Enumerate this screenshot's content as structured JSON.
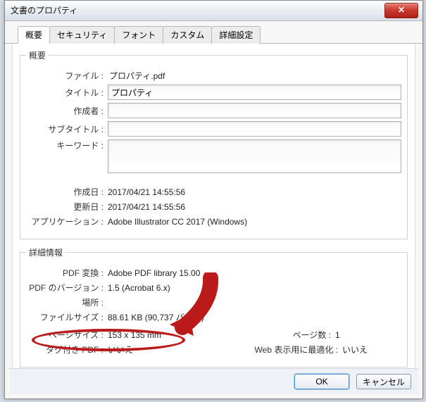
{
  "window": {
    "title": "文書のプロパティ"
  },
  "tabs": {
    "items": [
      {
        "label": "概要"
      },
      {
        "label": "セキュリティ"
      },
      {
        "label": "フォント"
      },
      {
        "label": "カスタム"
      },
      {
        "label": "詳細設定"
      }
    ]
  },
  "section_overview": {
    "legend": "概要",
    "file_label": "ファイル :",
    "file_value": "プロパティ.pdf",
    "title_label": "タイトル :",
    "title_value": "プロパティ",
    "author_label": "作成者 :",
    "author_value": "",
    "subtitle_label": "サブタイトル :",
    "subtitle_value": "",
    "keywords_label": "キーワード :",
    "keywords_value": "",
    "created_label": "作成日 :",
    "created_value": "2017/04/21 14:55:56",
    "updated_label": "更新日 :",
    "updated_value": "2017/04/21 14:55:56",
    "app_label": "アプリケーション :",
    "app_value": "Adobe Illustrator CC 2017 (Windows)"
  },
  "section_details": {
    "legend": "詳細情報",
    "pdf_converter_label": "PDF 変換 :",
    "pdf_converter_value": "Adobe PDF library 15.00",
    "pdf_version_label": "PDF のバージョン :",
    "pdf_version_value": "1.5 (Acrobat 6.x)",
    "location_label": "場所 :",
    "location_value": "",
    "filesize_label": "ファイルサイズ :",
    "filesize_value": "88.61 KB (90,737 バイト)",
    "pagesize_label": "ページサイズ :",
    "pagesize_value": "153 x 135 mm",
    "pagecount_label": "ページ数 :",
    "pagecount_value": "1",
    "taggedpdf_label": "タグ付き PDF :",
    "taggedpdf_value": "いいえ",
    "webopt_label": "Web 表示用に最適化 :",
    "webopt_value": "いいえ"
  },
  "buttons": {
    "ok": "OK",
    "cancel": "キャンセル"
  }
}
